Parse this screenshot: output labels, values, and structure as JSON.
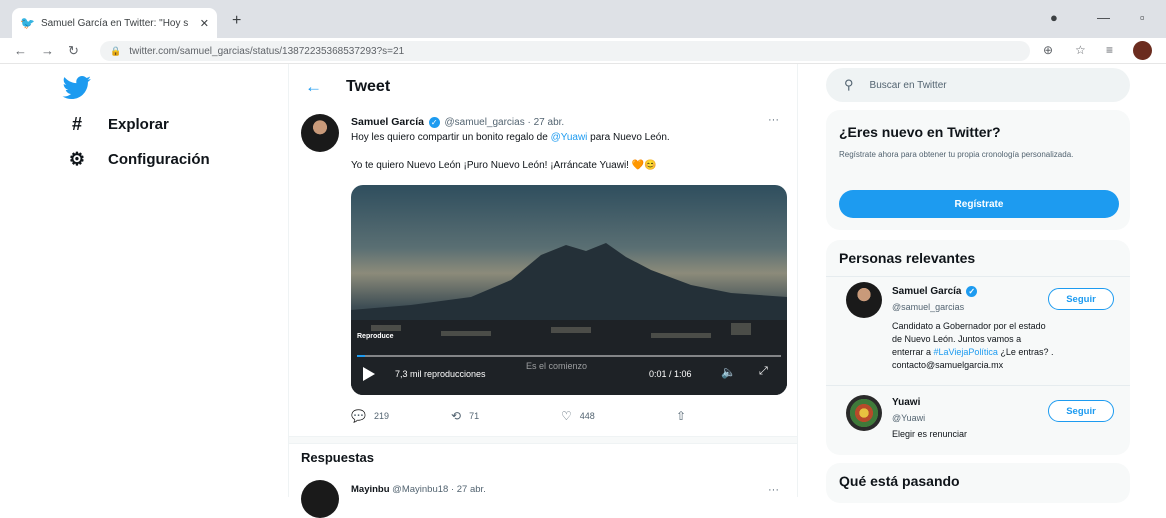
{
  "browser": {
    "tab_title": "Samuel García en Twitter: \"Hoy s",
    "url": "twitter.com/samuel_garcias/status/13872235368537293?s=21"
  },
  "colors": {
    "accent": "#1d9bf0",
    "text": "#0f1419",
    "muted": "#536471"
  },
  "nav": {
    "items": [
      {
        "icon": "hashtag-icon",
        "label": "Explorar"
      },
      {
        "icon": "gear-icon",
        "label": "Configuración"
      }
    ]
  },
  "header": {
    "title": "Tweet"
  },
  "tweet": {
    "author_name": "Samuel García",
    "handle_date": "@samuel_garcias · 27 abr.",
    "text1_pre": "Hoy les quiero compartir un bonito regalo de ",
    "mention": "@Yuawi",
    "text1_post": " para Nuevo León.",
    "text2": "Yo te quiero Nuevo León ¡Puro Nuevo León! ¡Arráncate Yuawi! 🧡😊",
    "video": {
      "label": "Reproduce",
      "views": "7,3 mil reproducciones",
      "caption": "Es el comienzo",
      "time": "0:01 / 1:06",
      "progress": 0.02
    },
    "replies": "219",
    "retweets": "71",
    "likes": "448"
  },
  "responses": {
    "title": "Respuestas",
    "first_reply_name": "Mayinbu",
    "first_reply_meta": "@Mayinbu18 · 27 abr."
  },
  "sidebar": {
    "search_placeholder": "Buscar en Twitter",
    "signup": {
      "title": "¿Eres nuevo en Twitter?",
      "desc": "Regístrate ahora para obtener tu propia cronología personalizada.",
      "button": "Regístrate"
    },
    "relevant": {
      "title": "Personas relevantes",
      "people": [
        {
          "name": "Samuel García",
          "handle": "@samuel_garcias",
          "bio_line1": "Candidato a Gobernador por el estado",
          "bio_line2": "de Nuevo León. Juntos vamos a",
          "bio_line3_pre": "enterrar a ",
          "bio_line3_link": "#LaViejaPolítica",
          "bio_line3_post": " ¿Le entras? .",
          "bio_line4": "contacto@samuelgarcia.mx",
          "follow": "Seguir"
        },
        {
          "name": "Yuawi",
          "handle": "@Yuawi",
          "bio_line1": "Elegir es renunciar",
          "follow": "Seguir"
        }
      ]
    },
    "trending": {
      "title": "Qué está pasando"
    }
  }
}
